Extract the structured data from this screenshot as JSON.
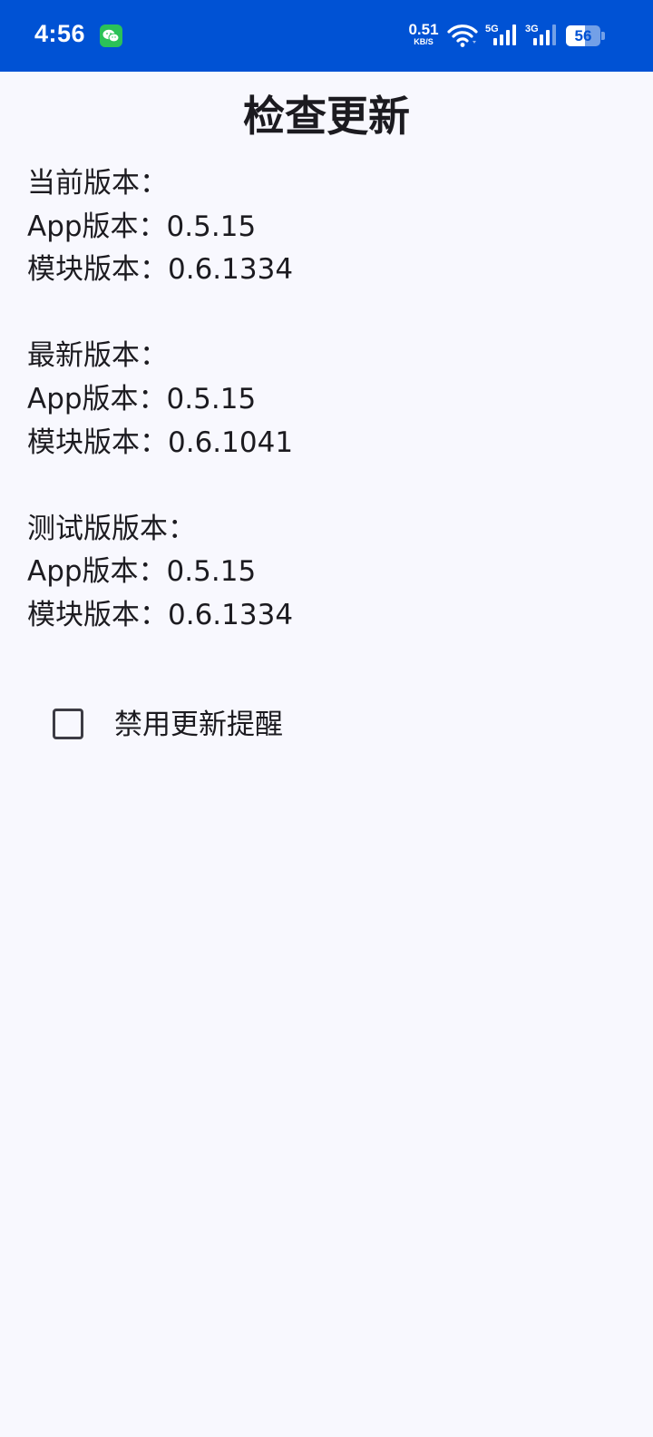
{
  "status_bar": {
    "time": "4:56",
    "net_speed_value": "0.51",
    "net_speed_unit": "KB/S",
    "signal_1_label": "5G",
    "signal_2_label": "3G",
    "battery_level": "56",
    "battery_fraction": 0.56,
    "background_color": "#0052d4",
    "notification_icon": "wechat-icon"
  },
  "page": {
    "title": "检查更新"
  },
  "current": {
    "heading": "当前版本：",
    "app_version": "App版本：0.5.15",
    "module_version": "模块版本：0.6.1334"
  },
  "latest": {
    "heading": "最新版本：",
    "app_version": "App版本：0.5.15",
    "module_version": "模块版本：0.6.1041"
  },
  "beta": {
    "heading": "测试版版本：",
    "app_version": "App版本：0.5.15",
    "module_version": "模块版本：0.6.1334"
  },
  "settings": {
    "disable_update_reminder_label": "禁用更新提醒",
    "disable_update_reminder_checked": false
  }
}
